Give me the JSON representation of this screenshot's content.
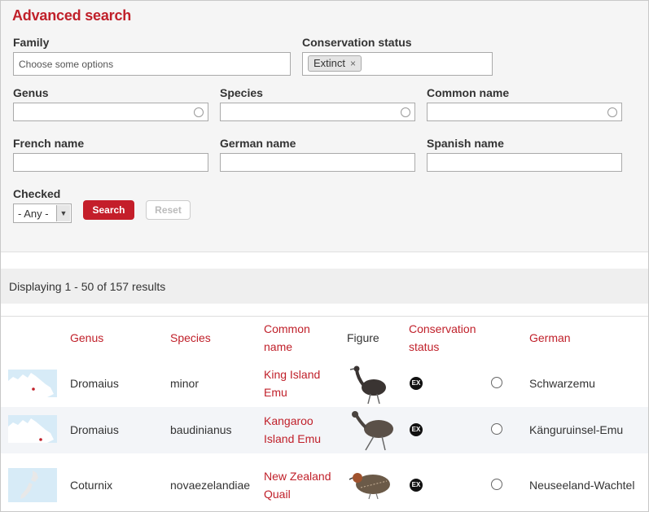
{
  "form": {
    "title": "Advanced search",
    "family": {
      "label": "Family",
      "placeholder": "Choose some options"
    },
    "conservation": {
      "label": "Conservation status",
      "chip": "Extinct",
      "chip_remove": "×"
    },
    "genus": {
      "label": "Genus"
    },
    "species": {
      "label": "Species"
    },
    "common_name": {
      "label": "Common name"
    },
    "french_name": {
      "label": "French name"
    },
    "german_name": {
      "label": "German name"
    },
    "spanish_name": {
      "label": "Spanish name"
    },
    "checked": {
      "label": "Checked",
      "value": "- Any -"
    },
    "search_label": "Search",
    "reset_label": "Reset"
  },
  "results": {
    "summary": "Displaying 1 - 50 of 157 results"
  },
  "table": {
    "headers": {
      "genus": "Genus",
      "species": "Species",
      "common_1": "Common",
      "common_2": "name",
      "figure": "Figure",
      "conservation_1": "Conservation",
      "conservation_2": "status",
      "german": "German"
    },
    "rows": [
      {
        "genus": "Dromaius",
        "species": "minor",
        "common_1": "King Island",
        "common_2": "Emu",
        "status": "EX",
        "german": "Schwarzemu",
        "map_icon": "australia-map-icon",
        "figure_icon": "emu-icon"
      },
      {
        "genus": "Dromaius",
        "species": "baudinianus",
        "common_1": "Kangaroo",
        "common_2": "Island Emu",
        "status": "EX",
        "german": "Känguruinsel-Emu",
        "map_icon": "australia-map-icon",
        "figure_icon": "emu-icon"
      },
      {
        "genus": "Coturnix",
        "species": "novaezelandiae",
        "common_1": "New Zealand",
        "common_2": "Quail",
        "status": "EX",
        "german": "Neuseeland-Wachtel",
        "map_icon": "new-zealand-map-icon",
        "figure_icon": "quail-icon"
      }
    ]
  },
  "colors": {
    "accent": "#c0202a",
    "button": "#c41e2a",
    "row_alt": "#f3f5f8",
    "map_water": "#d7ebf7"
  }
}
